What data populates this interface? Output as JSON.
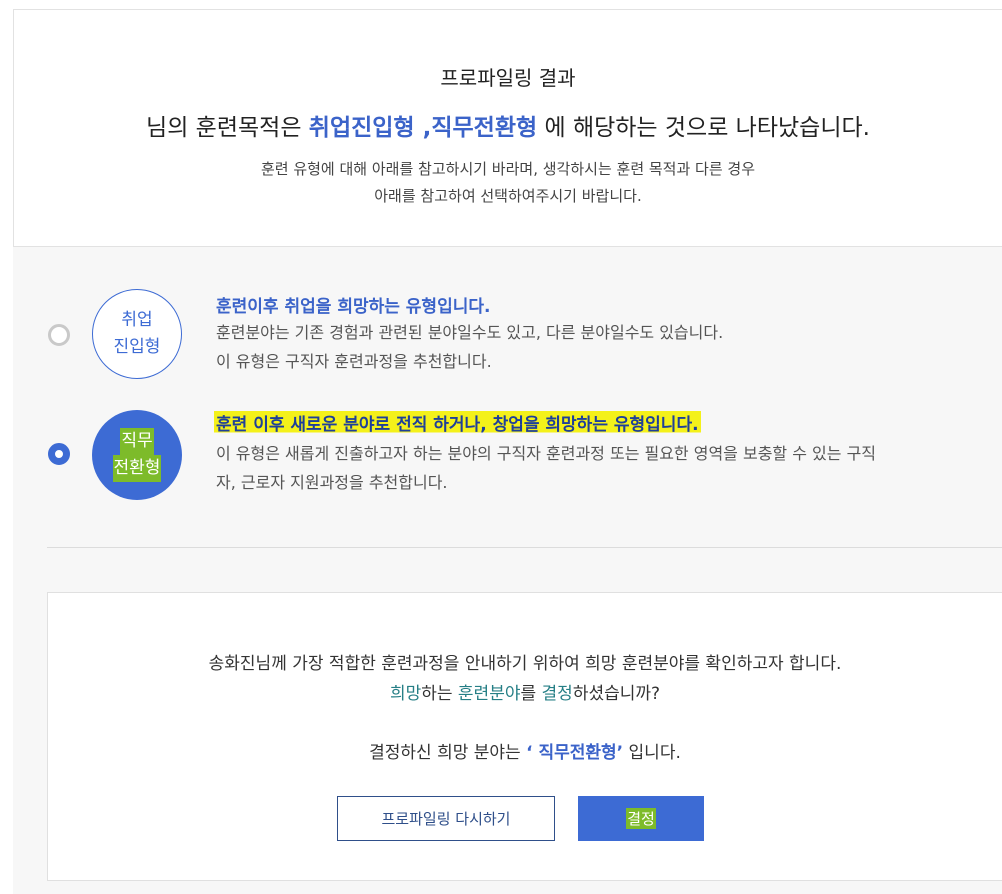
{
  "header": {
    "title": "프로파일링 결과",
    "result_prefix": "님의 훈련목적은 ",
    "result_types": "취업진입형 ,직무전환형",
    "result_suffix": " 에 해당하는 것으로 나타났습니다.",
    "desc_line1": "훈련 유형에 대해 아래를 참고하시기 바라며, 생각하시는 훈련 목적과 다른 경우",
    "desc_line2": "아래를 참고하여 선택하여주시기 바랍니다."
  },
  "options": [
    {
      "selected": false,
      "badge_line1": "취업",
      "badge_line2": "진입형",
      "heading": "훈련이후 취업을 희망하는 유형입니다.",
      "text_line1": "훈련분야는 기존 경험과 관련된 분야일수도 있고, 다른 분야일수도 있습니다.",
      "text_line2": "이 유형은 구직자 훈련과정을 추천합니다."
    },
    {
      "selected": true,
      "badge_line1": "직무",
      "badge_line2": "전환형",
      "heading": "훈련 이후 새로운 분야로 전직 하거나, 창업을 희망하는 유형입니다.",
      "text_line1": "이 유형은 새롭게 진출하고자 하는 분야의 구직자 훈련과정 또는 필요한 영역을 보충할 수 있는 구직",
      "text_line2": "자, 근로자 지원과정을 추천합니다."
    }
  ],
  "confirm": {
    "line1": "송화진님께 가장 적합한 훈련과정을 안내하기 위하여 희망 훈련분야를 확인하고자 합니다.",
    "q_word1": "희망",
    "q_mid1": "하는 ",
    "q_word2": "훈련분야",
    "q_mid2": "를 ",
    "q_word3": "결정",
    "q_end": "하셨습니까?",
    "decision_prefix": "결정하신 희망 분야는 ",
    "decision_value": "‘ 직무전환형’",
    "decision_suffix": " 입니다.",
    "redo_button": "프로파일링 다시하기",
    "decide_button": "결정"
  },
  "colors": {
    "accent": "#3d6bd4",
    "teal": "#267f86",
    "highlight": "#f4f11a",
    "mark_green": "#7dbb2a"
  }
}
